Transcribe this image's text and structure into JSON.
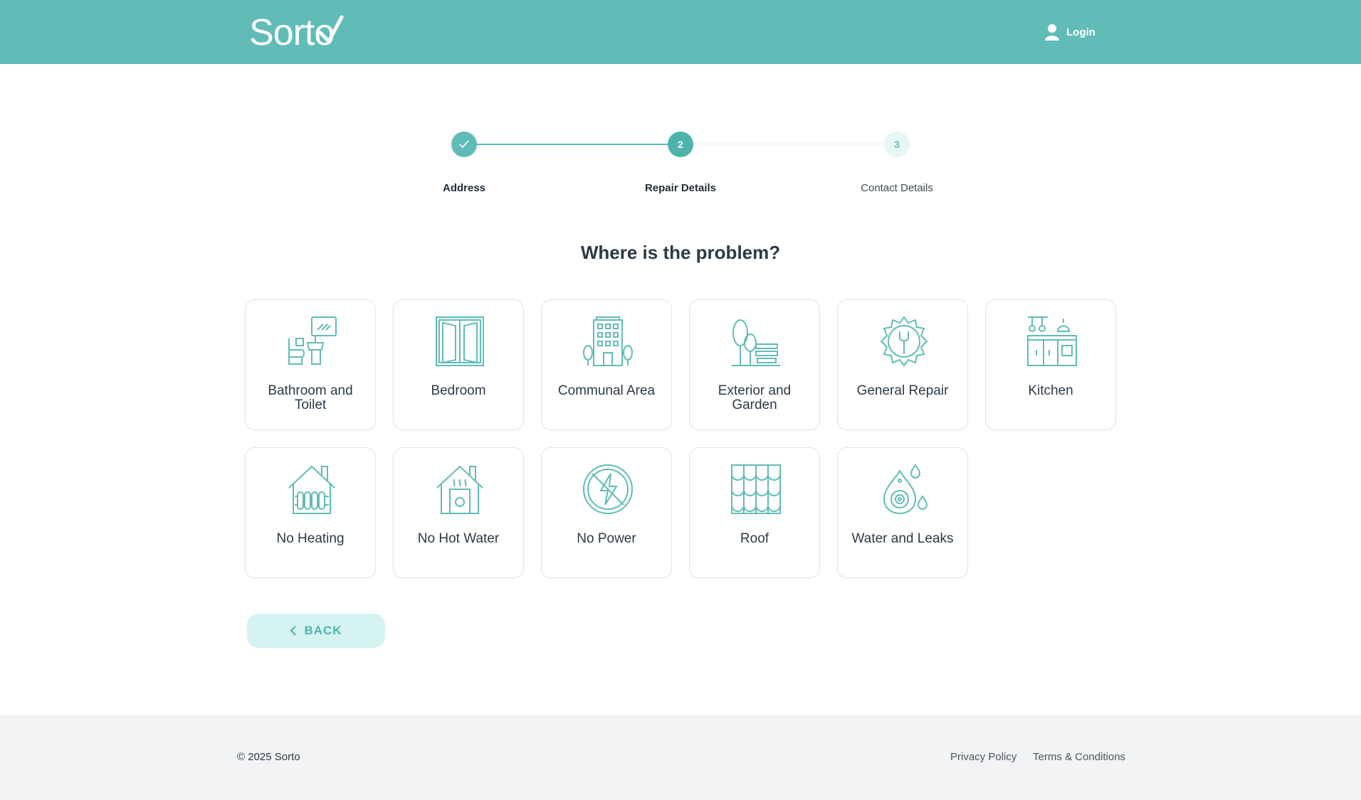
{
  "header": {
    "logo_text": "Sorto",
    "login_label": "Login"
  },
  "stepper": {
    "steps": [
      {
        "label": "Address",
        "number": "✓",
        "state": "done"
      },
      {
        "label": "Repair Details",
        "number": "2",
        "state": "active"
      },
      {
        "label": "Contact Details",
        "number": "3",
        "state": "pending"
      }
    ]
  },
  "main": {
    "title": "Where is the problem?",
    "categories": [
      {
        "label": "Bathroom and Toilet",
        "icon": "bathroom-icon"
      },
      {
        "label": "Bedroom",
        "icon": "bedroom-window-icon"
      },
      {
        "label": "Communal Area",
        "icon": "building-icon"
      },
      {
        "label": "Exterior and Garden",
        "icon": "garden-icon"
      },
      {
        "label": "General Repair",
        "icon": "gear-wrench-icon"
      },
      {
        "label": "Kitchen",
        "icon": "kitchen-icon"
      },
      {
        "label": "No Heating",
        "icon": "radiator-house-icon"
      },
      {
        "label": "No Hot Water",
        "icon": "boiler-house-icon"
      },
      {
        "label": "No Power",
        "icon": "no-power-icon"
      },
      {
        "label": "Roof",
        "icon": "roof-tiles-icon"
      },
      {
        "label": "Water and Leaks",
        "icon": "water-drop-icon"
      }
    ],
    "back_label": "BACK"
  },
  "footer": {
    "copyright": "© 2025 Sorto",
    "privacy": "Privacy Policy",
    "terms": "Terms & Conditions"
  },
  "colors": {
    "accent": "#61bcb8",
    "accent_light": "#d5f3f0",
    "text_dark": "#2b3a47"
  }
}
